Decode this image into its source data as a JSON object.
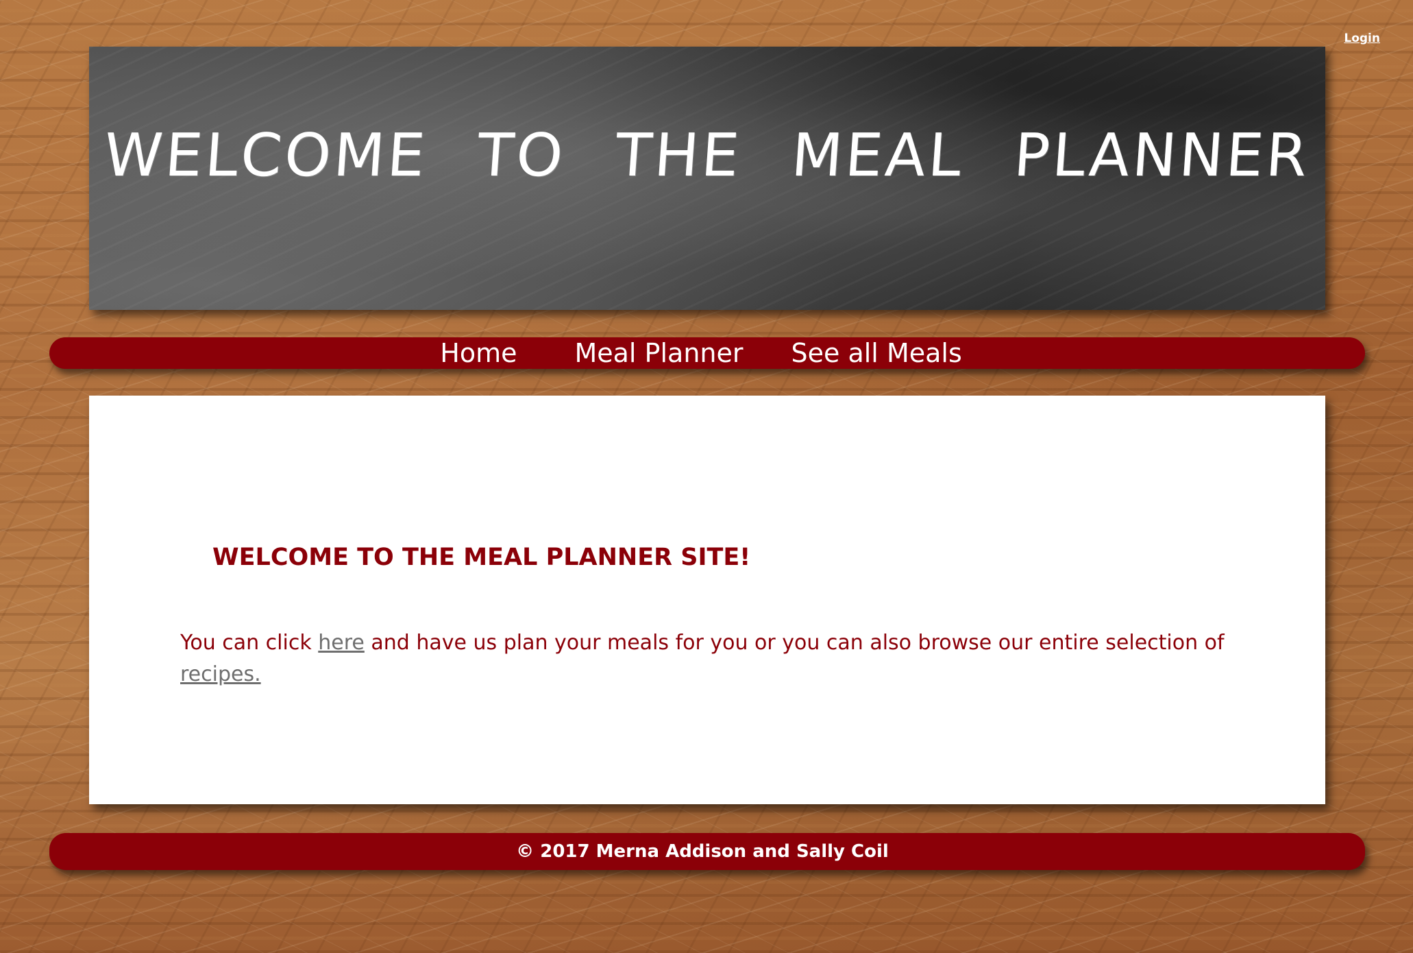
{
  "header": {
    "login_label": "Login",
    "banner_title": "WELCOME TO THE MEAL PLANNER"
  },
  "nav": {
    "items": [
      {
        "label": "Home"
      },
      {
        "label": "Meal Planner"
      },
      {
        "label": "See all Meals"
      }
    ]
  },
  "main": {
    "heading": "WELCOME TO THE MEAL PLANNER SITE!",
    "text_prefix": "You can click ",
    "here_link": "here",
    "text_middle": " and have us plan your meals for you or you can also browse our entire selection of ",
    "recipes_link": "recipes."
  },
  "footer": {
    "copyright": "© 2017 Merna Addison and Sally Coil"
  },
  "colors": {
    "accent": "#8b0008",
    "link": "#6e6e6e",
    "banner": "#3a3a3a"
  }
}
